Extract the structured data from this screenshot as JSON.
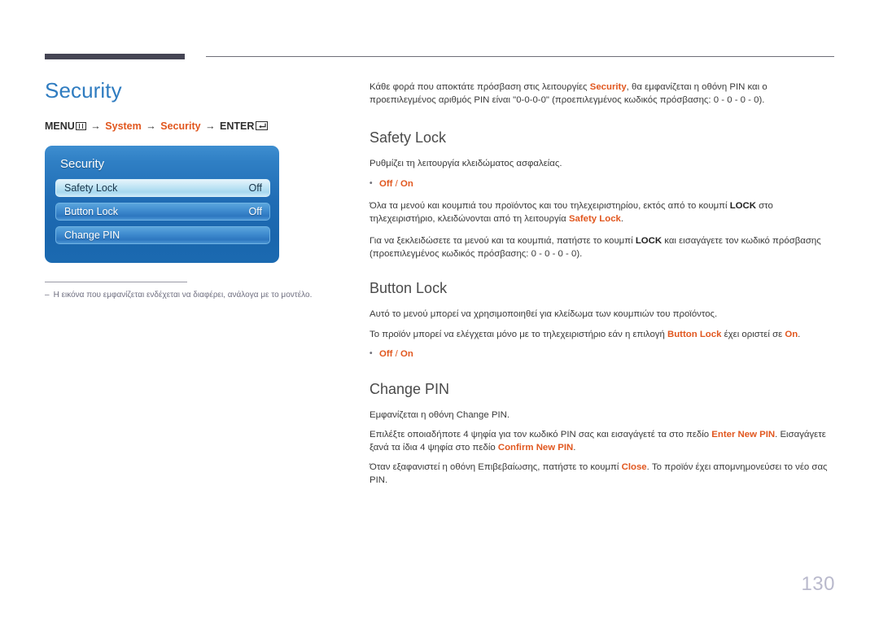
{
  "header": {
    "thick_bar": "decorative-dark-bar",
    "thin_rule": "decorative-thin-rule"
  },
  "left": {
    "page_title": "Security",
    "menu_path": {
      "menu_label": "MENU",
      "menu_icon": "menu-grid-icon",
      "arrow": "→",
      "step1": "System",
      "step2": "Security",
      "enter_label": "ENTER",
      "enter_icon": "enter-key-icon"
    },
    "osd": {
      "title": "Security",
      "rows": [
        {
          "label": "Safety Lock",
          "value": "Off",
          "selected": true
        },
        {
          "label": "Button Lock",
          "value": "Off",
          "selected": false
        },
        {
          "label": "Change PIN",
          "value": "",
          "selected": false
        }
      ]
    },
    "footnote": {
      "dash": "–",
      "text": "Η εικόνα που εμφανίζεται ενδέχεται να διαφέρει, ανάλογα με το μοντέλο."
    }
  },
  "right": {
    "intro": {
      "part1": "Κάθε φορά που αποκτάτε πρόσβαση στις λειτουργίες ",
      "accent1": "Security",
      "part2": ", θα εμφανίζεται η οθόνη PIN και ο προεπιλεγμένος αριθμός PIN είναι \"0-0-0-0\" (προεπιλεγμένος κωδικός πρόσβασης: 0 - 0 - 0 - 0)."
    },
    "safety_lock": {
      "heading": "Safety Lock",
      "desc": "Ρυθμίζει τη λειτουργία κλειδώματος ασφαλείας.",
      "bullet_off": "Off",
      "bullet_sep": " / ",
      "bullet_on": "On",
      "p2_part1": "Όλα τα μενού και κουμπιά του προϊόντος και του τηλεχειριστηρίου, εκτός από το κουμπί ",
      "p2_bold": "LOCK",
      "p2_part2": " στο τηλεχειριστήριο, κλειδώνονται από τη λειτουργία ",
      "p2_accent": "Safety Lock",
      "p2_part3": ".",
      "p3_part1": "Για να ξεκλειδώσετε τα μενού και τα κουμπιά, πατήστε το κουμπί ",
      "p3_bold": "LOCK",
      "p3_part2": " και εισαγάγετε τον κωδικό πρόσβασης (προεπιλεγμένος κωδικός πρόσβασης: 0 - 0 - 0 - 0)."
    },
    "button_lock": {
      "heading": "Button Lock",
      "desc": "Αυτό το μενού μπορεί να χρησιμοποιηθεί για κλείδωμα των κουμπιών του προϊόντος.",
      "p2_part1": "Το προϊόν μπορεί να ελέγχεται μόνο με το τηλεχειριστήριο εάν η επιλογή ",
      "p2_accent1": "Button Lock",
      "p2_part2": " έχει οριστεί σε ",
      "p2_accent2": "On",
      "p2_part3": ".",
      "bullet_off": "Off",
      "bullet_sep": " / ",
      "bullet_on": "On"
    },
    "change_pin": {
      "heading": "Change PIN",
      "p1": "Εμφανίζεται η οθόνη Change PIN.",
      "p2_part1": "Επιλέξτε οποιαδήποτε 4 ψηφία για τον κωδικό PIN σας και εισαγάγετέ τα στο πεδίο ",
      "p2_accent1": "Enter New PIN",
      "p2_part2": ". Εισαγάγετε ξανά τα ίδια 4 ψηφία στο πεδίο ",
      "p2_accent2": "Confirm New PIN",
      "p2_part3": ".",
      "p3_part1": "Όταν εξαφανιστεί η οθόνη Επιβεβαίωσης, πατήστε το κουμπί ",
      "p3_accent": "Close",
      "p3_part2": ". Το προϊόν έχει απομνημονεύσει το νέο σας PIN."
    }
  },
  "page_number": "130",
  "colors": {
    "title_blue": "#2f7cc0",
    "accent_orange": "#e1571f",
    "panel_blue": "#1f6cb4",
    "page_num_gray": "#b9b9cc",
    "rule_dark": "#454554"
  }
}
